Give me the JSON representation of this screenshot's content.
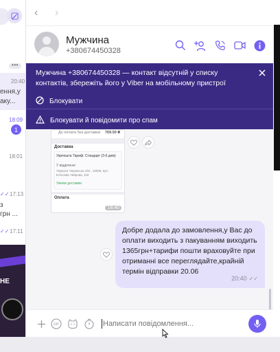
{
  "chat_list": {
    "more_label": "•••",
    "items": [
      {
        "time": "20:40",
        "snippet": [
          "ення,у",
          "аку..."
        ]
      },
      {
        "time": "18:09",
        "badge": "1"
      },
      {
        "time": "18:01"
      },
      {
        "time": "17:13",
        "snippet": [
          "з",
          "грн ..."
        ]
      },
      {
        "time": "17:11"
      }
    ],
    "promo_text": [
      "НЕ"
    ]
  },
  "header": {
    "contact_name": "Мужчина",
    "contact_phone": "+380674450328",
    "icons": [
      "search-icon",
      "add-participant-icon",
      "phone-call-icon",
      "video-call-icon",
      "info-icon"
    ]
  },
  "banner": {
    "message": "Мужчина +380674450328 — контакт відсутній у списку контактів, збережіть його у Viber на мобільному пристрої",
    "block_label": "Блокувати",
    "block_report_label": "Блокувати й повідомити про спам"
  },
  "image_message": {
    "line_top": "До оплати без доставки:",
    "amount": "769.50 ₴",
    "delivery_title": "Доставка",
    "delivery_service": "Укрпошта Тариф: Стандарт (3-6 днів)",
    "delivery_point": "У відділенні",
    "address": "Черкаси Черкаська обл., 18005, вул. Еліссава Чайрова, 118",
    "free_label": "Умови доставки",
    "payment_title": "Оплата",
    "time": "18:40"
  },
  "outgoing_message": {
    "text": "Добре додала до замовлення,у Вас до оплати виходить з пакуванням виходить 1365грн+тарифи пошти враховуйте при отриманні все переглядайте,крайній термін відправки 20.06",
    "time": "20:40"
  },
  "composer": {
    "placeholder": "Написати повідомлення...",
    "gif_label": "GIF"
  },
  "colors": {
    "accent": "#7360f2",
    "banner_bg": "#3b2a84",
    "outgoing_bubble": "#e4e0fb"
  }
}
